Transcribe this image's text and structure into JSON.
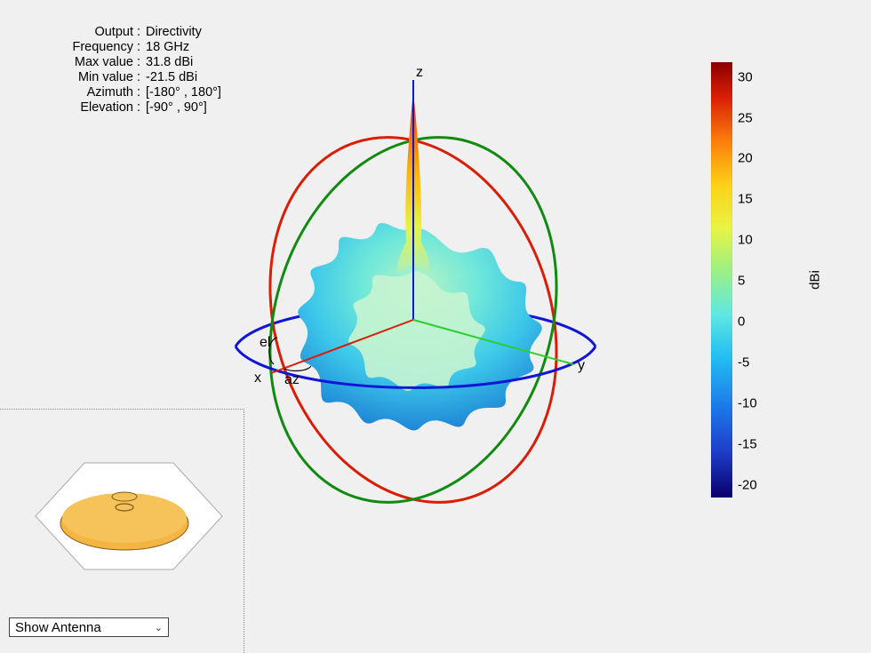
{
  "info": {
    "rows": [
      {
        "label": "Output",
        "value": "Directivity"
      },
      {
        "label": "Frequency",
        "value": "18 GHz"
      },
      {
        "label": "Max value",
        "value": "31.8 dBi"
      },
      {
        "label": "Min value",
        "value": "-21.5 dBi"
      },
      {
        "label": "Azimuth",
        "value": "[-180° , 180°]"
      },
      {
        "label": "Elevation",
        "value": "[-90° , 90°]"
      }
    ]
  },
  "axes": {
    "x": "x",
    "y": "y",
    "z": "z",
    "az": "az",
    "el": "el"
  },
  "colorbar": {
    "unit": "dBi",
    "ticks": [
      30,
      25,
      20,
      15,
      10,
      5,
      0,
      -5,
      -10,
      -15,
      -20
    ],
    "min": -21.5,
    "max": 31.8
  },
  "dropdown": {
    "selected": "Show Antenna"
  },
  "chart_data": {
    "type": "3d-radiation-pattern",
    "title": "Directivity",
    "frequency_GHz": 18,
    "axis_ranges": {
      "azimuth_deg": [
        -180,
        180
      ],
      "elevation_deg": [
        -90,
        90
      ]
    },
    "value_label": "Directivity",
    "value_unit": "dBi",
    "value_range": [
      -21.5,
      31.8
    ],
    "colorbar_ticks": [
      -20,
      -15,
      -10,
      -5,
      0,
      5,
      10,
      15,
      20,
      25,
      30
    ],
    "notes": "Highly directive main lobe along +z (boresight) peaking ~31.8 dBi; dense sidelobe structure over remaining sphere roughly -20 to +10 dBi. Three reference circles (red, green, blue) indicate principal coordinate planes with x/y/z axes and az/el angle markers.",
    "series": [
      {
        "name": "main_lobe_peak",
        "direction": "+z",
        "value_dBi": 31.8
      },
      {
        "name": "min_value",
        "value_dBi": -21.5
      }
    ]
  }
}
